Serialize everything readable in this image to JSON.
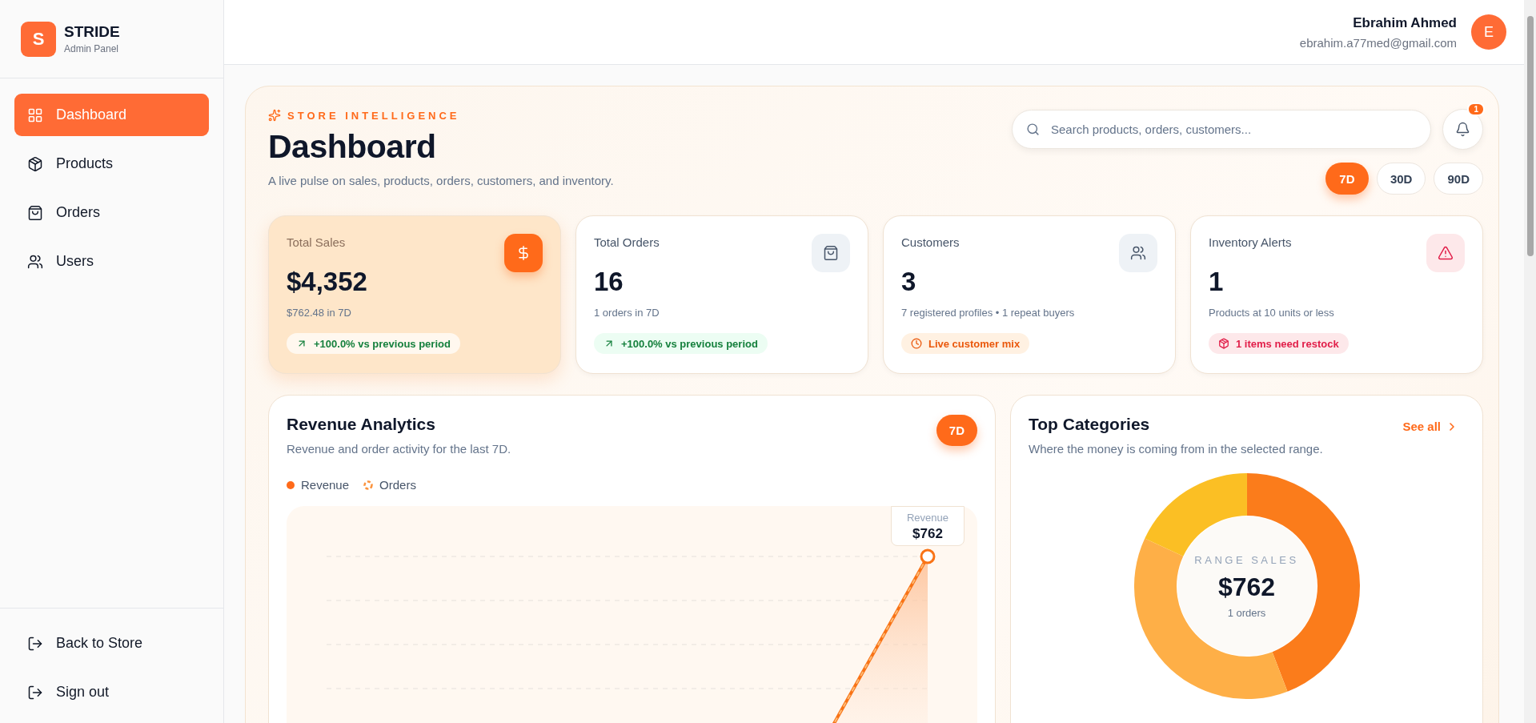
{
  "brand": {
    "logo_letter": "S",
    "name": "STRIDE",
    "subtitle": "Admin Panel"
  },
  "sidebar": {
    "items": [
      {
        "label": "Dashboard",
        "selected": true
      },
      {
        "label": "Products",
        "selected": false
      },
      {
        "label": "Orders",
        "selected": false
      },
      {
        "label": "Users",
        "selected": false
      }
    ],
    "footer_items": [
      {
        "label": "Back to Store"
      },
      {
        "label": "Sign out"
      }
    ]
  },
  "user": {
    "name": "Ebrahim Ahmed",
    "email": "ebrahim.a77med@gmail.com",
    "avatar_letter": "E"
  },
  "hero": {
    "eyebrow": "STORE INTELLIGENCE",
    "title": "Dashboard",
    "subtitle": "A live pulse on sales, products, orders, customers, and inventory.",
    "search": {
      "placeholder": "Search products, orders, customers..."
    },
    "notification_count": "1",
    "ranges": [
      {
        "label": "7D",
        "selected": true
      },
      {
        "label": "30D",
        "selected": false
      },
      {
        "label": "90D",
        "selected": false
      }
    ]
  },
  "stats": [
    {
      "kind": "sales",
      "label": "Total Sales",
      "value": "$4,352",
      "detail": "$762.48 in 7D",
      "badge": "+100.0% vs previous period",
      "highlight": true
    },
    {
      "kind": "orders",
      "label": "Total Orders",
      "value": "16",
      "detail": "1 orders in 7D",
      "badge": "+100.0% vs previous period",
      "highlight": false
    },
    {
      "kind": "customers",
      "label": "Customers",
      "value": "3",
      "detail": "7 registered profiles • 1 repeat buyers",
      "badge": "Live customer mix",
      "highlight": false
    },
    {
      "kind": "inventory",
      "label": "Inventory Alerts",
      "value": "1",
      "detail": "Products at 10 units or less",
      "badge": "1 items need restock",
      "highlight": false
    }
  ],
  "revenue": {
    "title": "Revenue Analytics",
    "subtitle": "Revenue and order activity for the last 7D.",
    "range": "7D",
    "legend": [
      {
        "label": "Revenue",
        "kind": "dot"
      },
      {
        "label": "Orders",
        "kind": "ring"
      }
    ],
    "tooltip": {
      "label": "Revenue",
      "value": "$762"
    }
  },
  "categories": {
    "title": "Top Categories",
    "subtitle": "Where the money is coming from in the selected range.",
    "link": "See all",
    "center": {
      "label": "RANGE SALES",
      "value": "$762",
      "detail": "1 orders"
    },
    "slices": [
      {
        "color": "#fb7c1b"
      },
      {
        "color": "#feaf47"
      },
      {
        "color": "#fbbf24"
      }
    ]
  }
}
